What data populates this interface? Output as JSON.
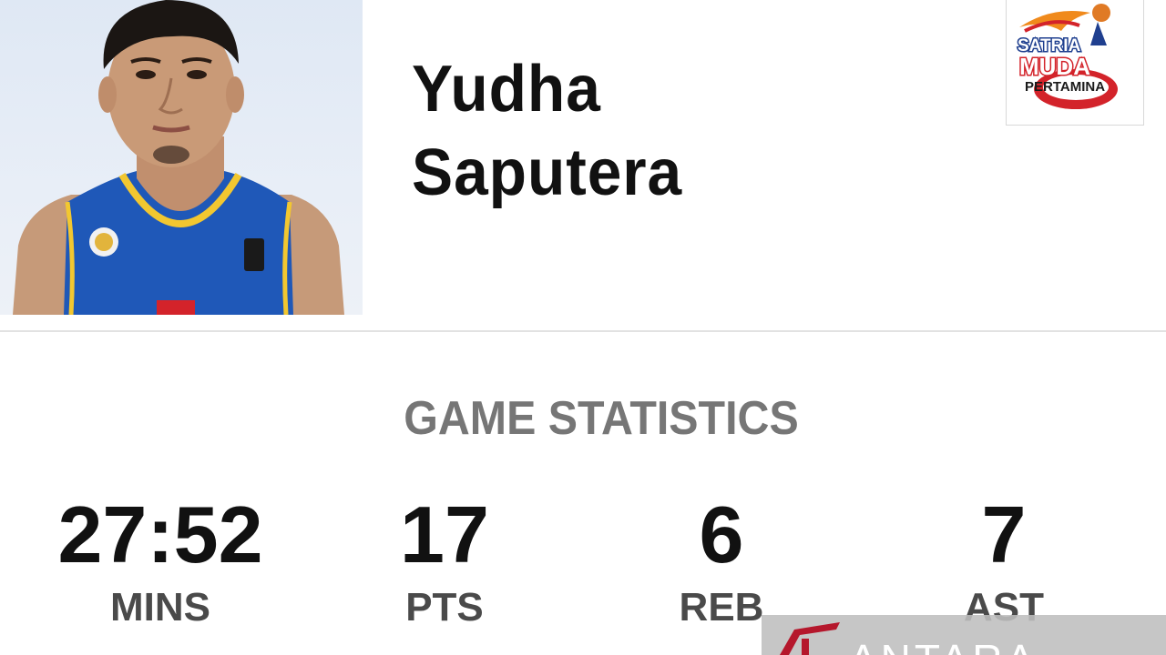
{
  "player": {
    "first_name": "Yudha",
    "last_name": "Saputera"
  },
  "team_logo": {
    "line1": "SATRIA",
    "line2": "MUDA",
    "line3": "PERTAMINA"
  },
  "section_title": "GAME STATISTICS",
  "stats": [
    {
      "value": "27:52",
      "label": "MINS"
    },
    {
      "value": "17",
      "label": "PTS"
    },
    {
      "value": "6",
      "label": "REB"
    },
    {
      "value": "7",
      "label": "AST"
    }
  ],
  "watermark": {
    "text": "ANTARA"
  },
  "colors": {
    "jersey": "#1f58b8",
    "jersey_trim": "#f2c730",
    "logo_red": "#d3232a",
    "logo_orange": "#f08a1c",
    "title_gray": "#767676"
  }
}
